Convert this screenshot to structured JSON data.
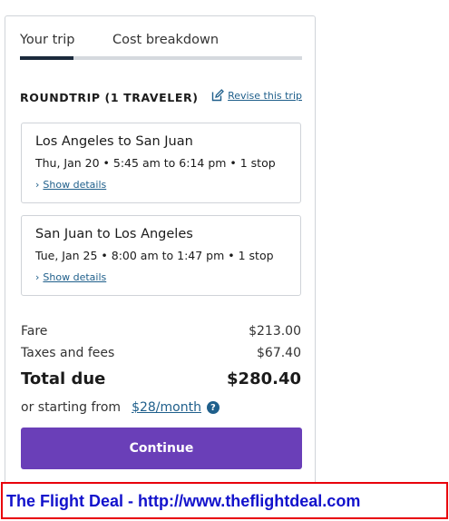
{
  "tabs": [
    {
      "label": "Your trip",
      "active": true
    },
    {
      "label": "Cost breakdown",
      "active": false
    }
  ],
  "trip": {
    "title": "ROUNDTRIP (1 TRAVELER)",
    "revise_label": "Revise this trip",
    "revise_icon": "edit-icon"
  },
  "legs": [
    {
      "route": "Los Angeles to San Juan",
      "times": "Thu, Jan 20 • 5:45 am to 6:14 pm • 1 stop",
      "details_label": "Show details",
      "details_icon": "chevron-right-icon"
    },
    {
      "route": "San Juan to Los Angeles",
      "times": "Tue, Jan 25 • 8:00 am to 1:47 pm • 1 stop",
      "details_label": "Show details",
      "details_icon": "chevron-right-icon"
    }
  ],
  "pricing": {
    "fare_label": "Fare",
    "fare_value": "$213.00",
    "taxes_label": "Taxes and fees",
    "taxes_value": "$67.40",
    "total_label": "Total due",
    "total_value": "$280.40",
    "starting_label": "or starting from",
    "starting_amount": "$28/month",
    "help_icon": "question-icon",
    "help_glyph": "?"
  },
  "continue_label": "Continue",
  "banner": {
    "text": "The Flight Deal - http://www.theflightdeal.com"
  },
  "colors": {
    "accent": "#6a3fb8",
    "link": "#1f5f8b",
    "tab_active": "#1b2a3c",
    "banner_border": "#e8000b",
    "banner_text": "#1212cc"
  }
}
